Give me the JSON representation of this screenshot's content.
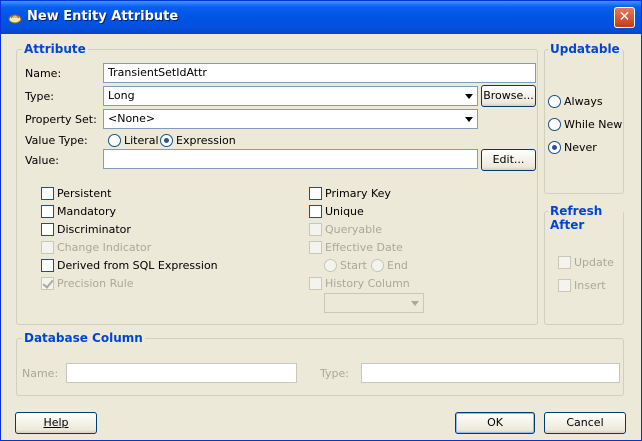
{
  "window": {
    "title": "New Entity Attribute",
    "close_glyph": "✕"
  },
  "attribute": {
    "group_title": "Attribute",
    "name_label": "Name:",
    "name_value": "TransientSetIdAttr",
    "type_label": "Type:",
    "type_value": "Long",
    "browse_label": "Browse...",
    "property_set_label": "Property Set:",
    "property_set_value": "<None>",
    "value_type_label": "Value Type:",
    "value_type_options": [
      "Literal",
      "Expression"
    ],
    "value_type_selected": "Expression",
    "value_label": "Value:",
    "value_value": "",
    "edit_label": "Edit...",
    "left_checks": [
      {
        "label": "Persistent",
        "checked": false,
        "enabled": true
      },
      {
        "label": "Mandatory",
        "checked": false,
        "enabled": true
      },
      {
        "label": "Discriminator",
        "checked": false,
        "enabled": true
      },
      {
        "label": "Change Indicator",
        "checked": false,
        "enabled": false
      },
      {
        "label": "Derived from SQL Expression",
        "checked": false,
        "enabled": true
      },
      {
        "label": "Precision Rule",
        "checked": true,
        "enabled": false
      }
    ],
    "right_checks": [
      {
        "label": "Primary Key",
        "checked": false,
        "enabled": true
      },
      {
        "label": "Unique",
        "checked": false,
        "enabled": true
      },
      {
        "label": "Queryable",
        "checked": false,
        "enabled": false
      },
      {
        "label": "Effective Date",
        "checked": false,
        "enabled": false
      }
    ],
    "effective_date_options": [
      "Start",
      "End"
    ],
    "history_column_label": "History Column",
    "history_column_value": ""
  },
  "updatable": {
    "group_title": "Updatable",
    "options": [
      "Always",
      "While New",
      "Never"
    ],
    "selected": "Never"
  },
  "refresh_after": {
    "group_title": "Refresh After",
    "options": [
      {
        "label": "Update",
        "checked": false
      },
      {
        "label": "Insert",
        "checked": false
      }
    ]
  },
  "database_column": {
    "group_title": "Database Column",
    "name_label": "Name:",
    "name_value": "",
    "type_label": "Type:",
    "type_value": ""
  },
  "footer": {
    "help_label": "Help",
    "ok_label": "OK",
    "cancel_label": "Cancel"
  },
  "colors": {
    "titlebar": "#0054e3",
    "dialog_bg": "#ece9d8",
    "group_title": "#0046d5",
    "disabled_text": "#aca899"
  }
}
